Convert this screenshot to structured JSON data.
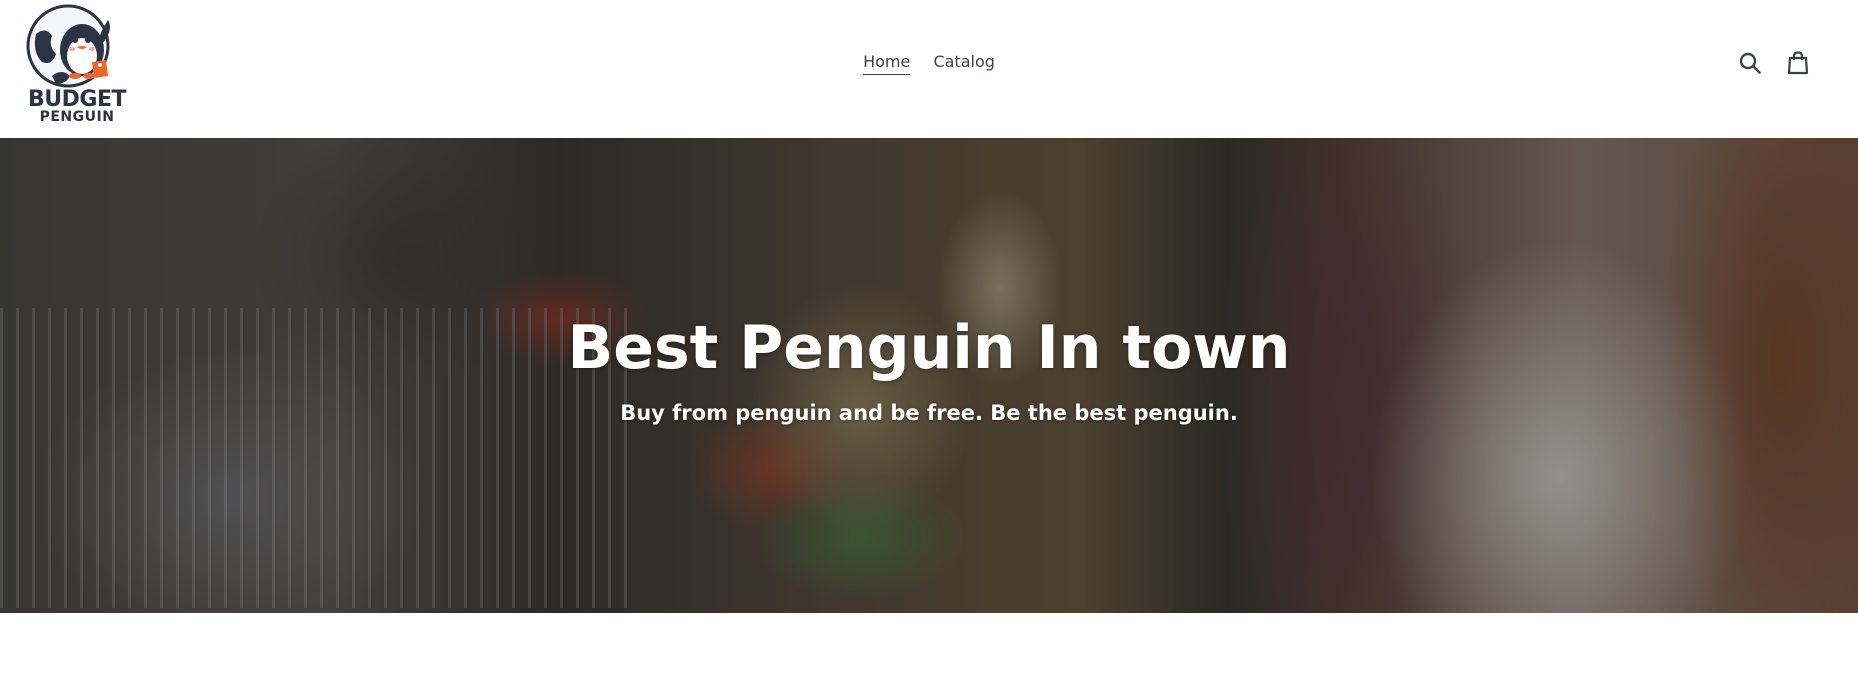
{
  "header": {
    "logo": {
      "line1": "BUDGET",
      "line2": "PENGUIN",
      "icon": "penguin-globe-logo",
      "accent_color": "#f2652a",
      "text_color": "#2b3344"
    },
    "nav": [
      {
        "label": "Home",
        "active": true
      },
      {
        "label": "Catalog",
        "active": false
      }
    ],
    "icons": [
      "search-icon",
      "cart-icon"
    ]
  },
  "hero": {
    "title": "Best Penguin In town",
    "subtitle": "Buy from penguin and be free. Be the best penguin."
  }
}
